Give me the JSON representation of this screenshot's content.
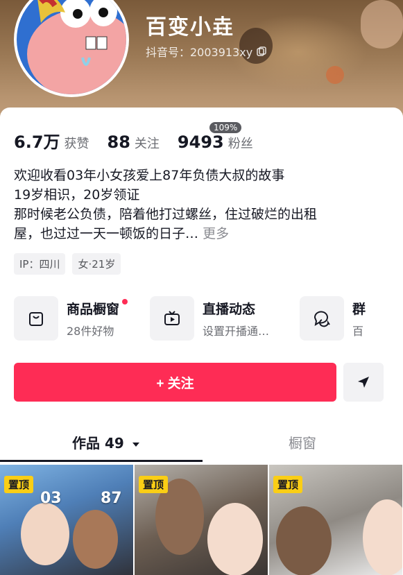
{
  "profile": {
    "nickname": "百变小垚",
    "douyin_id": "抖音号：2003913xy"
  },
  "stats": [
    {
      "num": "6.7万",
      "label": "获赞"
    },
    {
      "num": "88",
      "label": "关注"
    },
    {
      "num": "9493",
      "label": "粉丝"
    }
  ],
  "fans_growth_badge": "109%",
  "bio": {
    "line1": "欢迎收看03年小女孩爱上87年负债大叔的故事",
    "line2": "19岁相识，20岁领证",
    "line3": "那时候老公负债，陪着他打过螺丝，住过破烂的出租",
    "line4": "屋，也过过一天一顿饭的日子…",
    "more": "更多"
  },
  "tags": [
    "IP：四川",
    "女·21岁"
  ],
  "shortcuts": [
    {
      "title": "商品橱窗",
      "sub": "28件好物",
      "icon": "bag-icon"
    },
    {
      "title": "直播动态",
      "sub": "设置开播通…",
      "icon": "tv-icon"
    },
    {
      "title": "群",
      "sub": "百",
      "icon": "chat-icon"
    }
  ],
  "follow_label": "+ 关注",
  "tabs": {
    "works": "作品 49",
    "window": "橱窗"
  },
  "videos": [
    {
      "pin": "置顶",
      "overlay_left": "03",
      "overlay_right": "87"
    },
    {
      "pin": "置顶"
    },
    {
      "pin": "置顶"
    }
  ],
  "colors": {
    "accent": "#fe2c55",
    "pin": "#face15"
  }
}
